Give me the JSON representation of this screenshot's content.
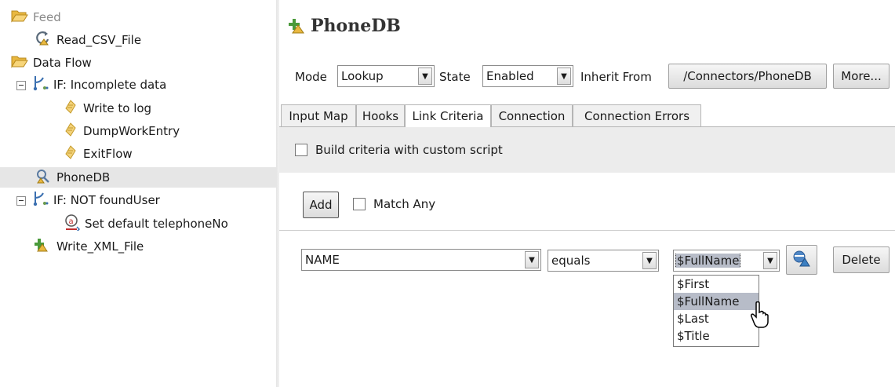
{
  "tree": {
    "items": [
      {
        "label": "Feed",
        "icon": "open-folder-icon"
      },
      {
        "label": "Read_CSV_File",
        "icon": "connector-refresh-icon"
      },
      {
        "label": "Data Flow",
        "icon": "open-folder-icon"
      },
      {
        "label": "IF: Incomplete data",
        "icon": "branch-icon"
      },
      {
        "label": "Write to log",
        "icon": "script-icon"
      },
      {
        "label": "DumpWorkEntry",
        "icon": "script-icon"
      },
      {
        "label": "ExitFlow",
        "icon": "script-icon"
      },
      {
        "label": "PhoneDB",
        "icon": "lookup-connector-icon"
      },
      {
        "label": "IF: NOT foundUser",
        "icon": "branch-icon"
      },
      {
        "label": "Set default telephoneNo",
        "icon": "attribute-map-icon"
      },
      {
        "label": "Write_XML_File",
        "icon": "add-connector-icon"
      }
    ]
  },
  "panel": {
    "title": "PhoneDB",
    "mode_label": "Mode",
    "mode_value": "Lookup",
    "state_label": "State",
    "state_value": "Enabled",
    "inherit_label": "Inherit From",
    "inherit_button": "/Connectors/PhoneDB",
    "more_button": "More..."
  },
  "tabs": [
    "Input Map",
    "Hooks",
    "Link Criteria",
    "Connection",
    "Connection Errors"
  ],
  "active_tab": "Link Criteria",
  "link_criteria": {
    "custom_script_label": "Build criteria with custom script",
    "add_button": "Add",
    "match_any_label": "Match Any",
    "attribute_value": "NAME",
    "operator_value": "equals",
    "value_value": "$FullName",
    "delete_button": "Delete",
    "value_options": [
      "$First",
      "$FullName",
      "$Last",
      "$Title"
    ],
    "highlighted_option": "$FullName"
  },
  "colors": {
    "folder": "#e9b840",
    "accent": "#3c7fc1",
    "selection": "#e6e6e6",
    "highlight": "#b7bcc8"
  }
}
